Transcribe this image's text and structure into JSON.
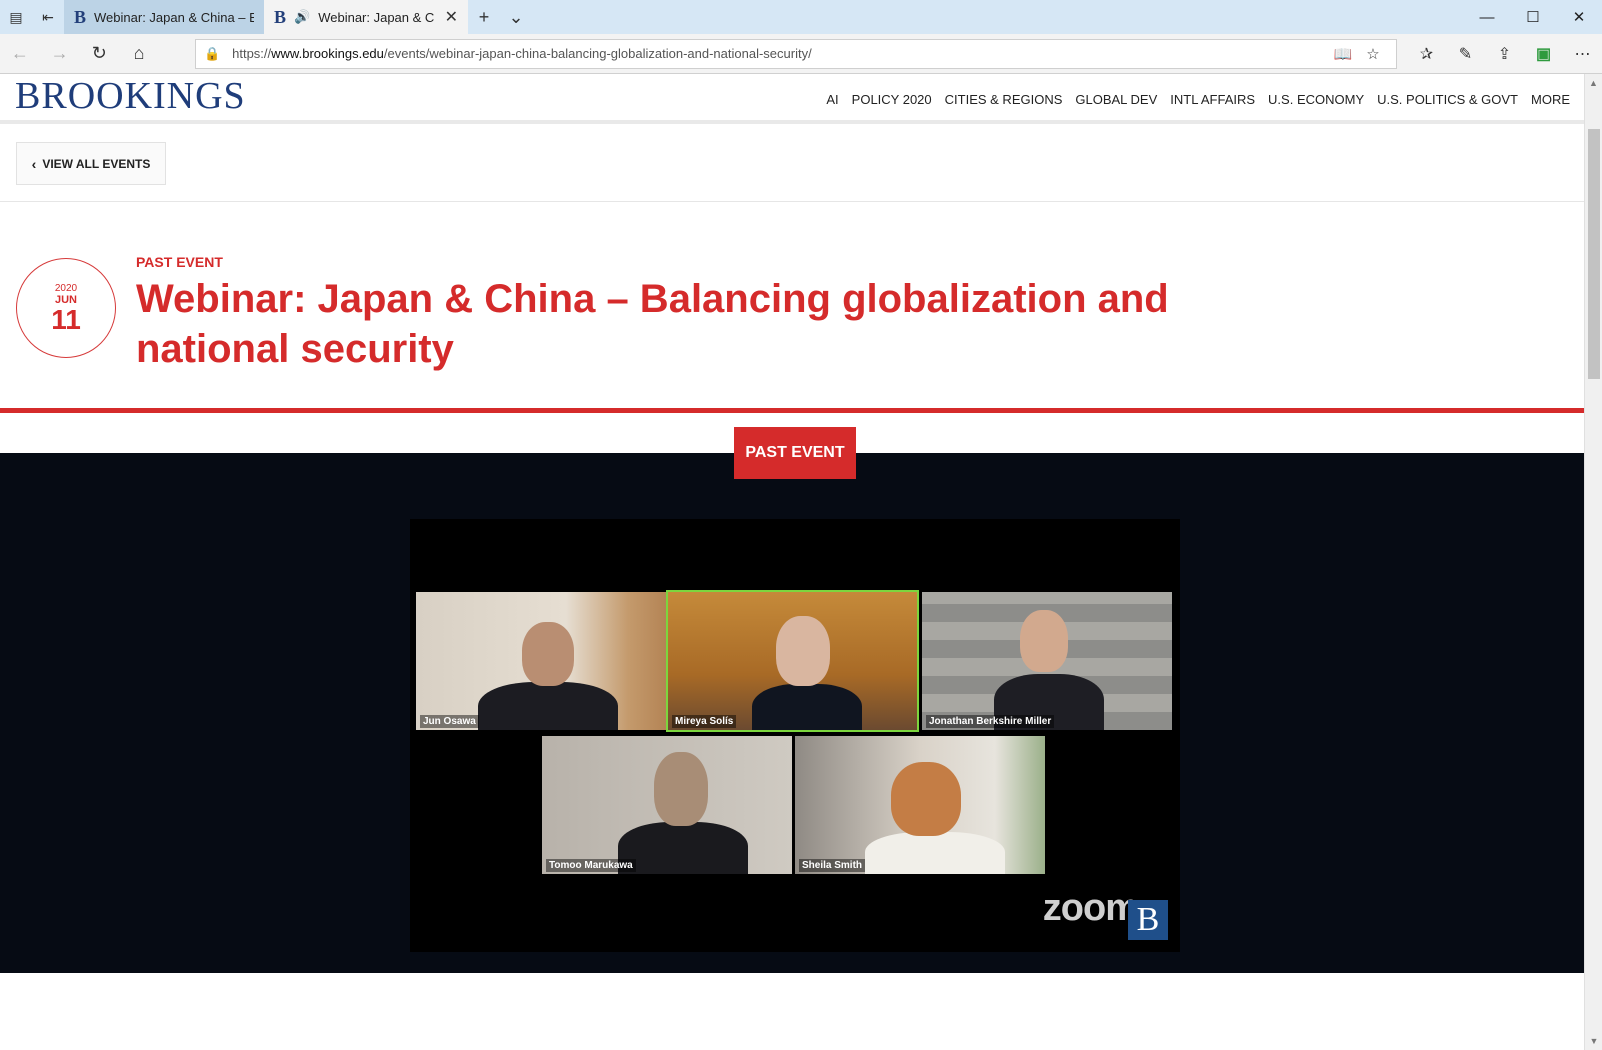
{
  "browser": {
    "tabs": [
      {
        "favicon": "B",
        "label": "Webinar: Japan & China – B",
        "active": false
      },
      {
        "favicon": "B",
        "label": "Webinar: Japan & C",
        "active": true,
        "audio": true
      }
    ],
    "url_prefix": "https://",
    "url_domain": "www.brookings.edu",
    "url_path": "/events/webinar-japan-china-balancing-globalization-and-national-security/"
  },
  "site": {
    "logo": "BROOKINGS",
    "nav": [
      "AI",
      "POLICY 2020",
      "CITIES & REGIONS",
      "GLOBAL DEV",
      "INTL AFFAIRS",
      "U.S. ECONOMY",
      "U.S. POLITICS & GOVT",
      "MORE"
    ]
  },
  "back_link": "VIEW ALL EVENTS",
  "event": {
    "date_year": "2020",
    "date_month": "JUN",
    "date_day": "11",
    "eyebrow": "PAST EVENT",
    "title": "Webinar: Japan & China – Balancing globalization and national security",
    "badge": "PAST EVENT"
  },
  "video": {
    "participants": [
      "Jun Osawa",
      "Mireya Solís",
      "Jonathan Berkshire Miller",
      "Tomoo Marukawa",
      "Sheila Smith"
    ],
    "watermark": "zoom",
    "corner_logo": "B"
  },
  "colors": {
    "brand_red": "#d52b2b",
    "brand_blue": "#1f3d7a",
    "active_speaker": "#7cd63e"
  }
}
